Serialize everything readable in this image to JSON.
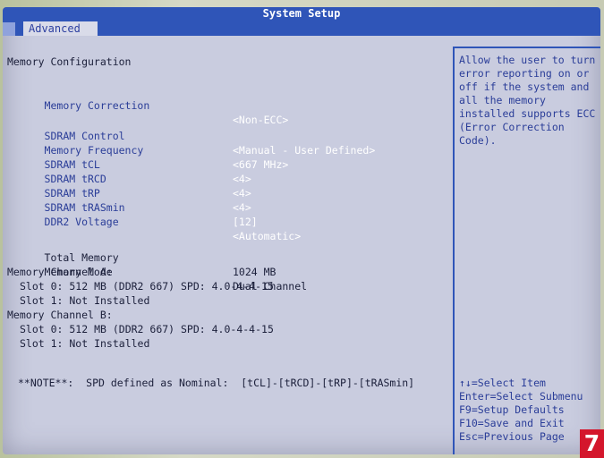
{
  "window": {
    "title": "System Setup"
  },
  "tabs": {
    "active": "Advanced"
  },
  "section_title": "Memory Configuration",
  "settings": [
    {
      "label": "Memory Correction",
      "value": "<Non-ECC>"
    },
    {
      "label": "SDRAM Control",
      "value": "<Manual - User Defined>"
    },
    {
      "label": "Memory Frequency",
      "value": "<667 MHz>"
    },
    {
      "label": "SDRAM tCL",
      "value": "<4>"
    },
    {
      "label": "SDRAM tRCD",
      "value": "<4>"
    },
    {
      "label": "SDRAM tRP",
      "value": "<4>"
    },
    {
      "label": "SDRAM tRASmin",
      "value": "[12]"
    },
    {
      "label": "DDR2 Voltage",
      "value": "<Automatic>"
    }
  ],
  "info": {
    "total_memory_label": "Total Memory",
    "total_memory_value": "1024 MB",
    "memory_mode_label": "Memory Mode",
    "memory_mode_value": "Dual Channel",
    "channel_a_label": "Memory Channel A:",
    "channel_a_slot0": "Slot 0: 512 MB (DDR2 667) SPD: 4.0-4-4-15",
    "channel_a_slot1": "Slot 1: Not Installed",
    "channel_b_label": "Memory Channel B:",
    "channel_b_slot0": "Slot 0: 512 MB (DDR2 667) SPD: 4.0-4-4-15",
    "channel_b_slot1": "Slot 1: Not Installed"
  },
  "note": "**NOTE**:  SPD defined as Nominal:  [tCL]-[tRCD]-[tRP]-[tRASmin]",
  "help_lines": [
    "Allow the user to turn",
    "error reporting on or",
    "off if the system and",
    "all the memory",
    "installed supports ECC",
    "(Error Correction",
    "Code)."
  ],
  "key_legend": [
    "↑↓=Select Item",
    "Enter=Select Submenu",
    "F9=Setup Defaults",
    "F10=Save and Exit",
    "Esc=Previous Page"
  ],
  "corner_badge": "7",
  "colors": {
    "title_bar": "#2f55b8",
    "label_text": "#2a3d98",
    "selected_value": "#ffffff",
    "background": "#c9ccdf",
    "badge": "#d4162c"
  }
}
